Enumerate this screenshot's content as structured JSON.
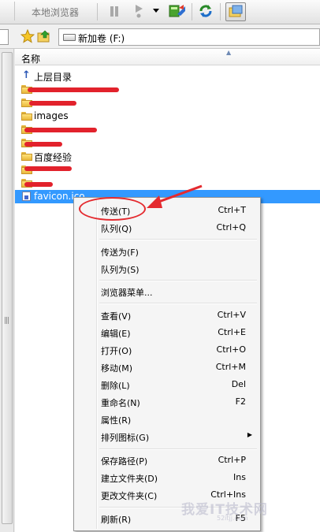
{
  "toolbar": {
    "local_browser_label": "本地浏览器"
  },
  "address": {
    "path": "新加卷 (F:)"
  },
  "list": {
    "column_name": "名称",
    "items": [
      {
        "label": "上层目录",
        "type": "up"
      },
      {
        "label": "",
        "type": "folder",
        "redacted": true
      },
      {
        "label": "",
        "type": "folder",
        "redacted": true
      },
      {
        "label": "images",
        "type": "folder"
      },
      {
        "label": "",
        "type": "folder",
        "redacted": true
      },
      {
        "label": "",
        "type": "folder",
        "redacted": true
      },
      {
        "label": "百度经验",
        "type": "folder"
      },
      {
        "label": "",
        "type": "folder",
        "redacted": true
      },
      {
        "label": "",
        "type": "folder",
        "redacted": true
      },
      {
        "label": "favicon.ico",
        "type": "file",
        "selected": true
      }
    ]
  },
  "context_menu": {
    "groups": [
      [
        {
          "label": "传送(T)",
          "shortcut": "Ctrl+T"
        },
        {
          "label": "队列(Q)",
          "shortcut": "Ctrl+Q"
        }
      ],
      [
        {
          "label": "传送为(F)",
          "shortcut": ""
        },
        {
          "label": "队列为(S)",
          "shortcut": ""
        }
      ],
      [
        {
          "label": "浏览器菜单...",
          "shortcut": ""
        }
      ],
      [
        {
          "label": "查看(V)",
          "shortcut": "Ctrl+V"
        },
        {
          "label": "编辑(E)",
          "shortcut": "Ctrl+E"
        },
        {
          "label": "打开(O)",
          "shortcut": "Ctrl+O"
        },
        {
          "label": "移动(M)",
          "shortcut": "Ctrl+M"
        },
        {
          "label": "删除(L)",
          "shortcut": "Del"
        },
        {
          "label": "重命名(N)",
          "shortcut": "F2"
        },
        {
          "label": "属性(R)",
          "shortcut": ""
        },
        {
          "label": "排列图标(G)",
          "shortcut": "",
          "submenu": true
        }
      ],
      [
        {
          "label": "保存路径(P)",
          "shortcut": "Ctrl+P"
        },
        {
          "label": "建立文件夹(D)",
          "shortcut": "Ins"
        },
        {
          "label": "更改文件夹(C)",
          "shortcut": "Ctrl+Ins"
        }
      ],
      [
        {
          "label": "刷新(R)",
          "shortcut": "F5"
        }
      ]
    ]
  },
  "watermark": {
    "main": "我爱IT技术网",
    "sub": "52itjj.com"
  },
  "colors": {
    "selection": "#3399ff",
    "annotation": "#e42a2f"
  }
}
